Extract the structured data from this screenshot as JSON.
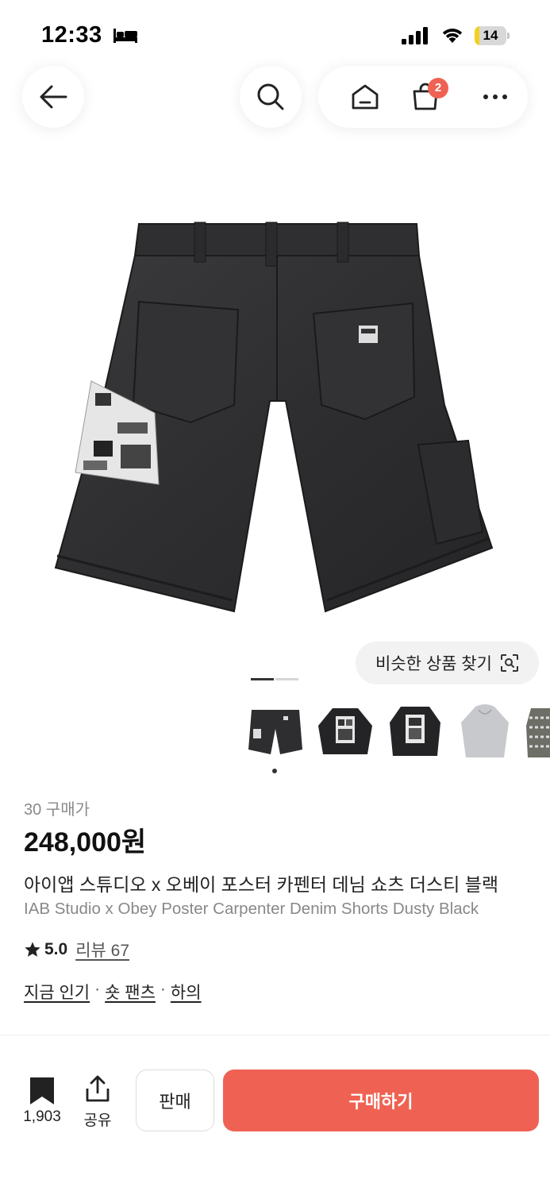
{
  "status_bar": {
    "time": "12:33",
    "battery_level": "14",
    "battery_fraction": 0.14
  },
  "nav": {
    "cart_count": "2"
  },
  "similar_search": {
    "label": "비슷한 상품 찾기"
  },
  "gallery": {
    "active_index": 0,
    "total_pages": 2
  },
  "product": {
    "buyer_count": "30 구매가",
    "price": "248,000원",
    "title_ko": "아이앱 스튜디오 x 오베이 포스터 카펜터 데님 쇼츠 더스티 블랙",
    "title_en": "IAB Studio x Obey Poster Carpenter Denim Shorts Dusty Black",
    "rating": "5.0",
    "reviews": "리뷰 67",
    "categories": [
      "지금 인기",
      "숏 팬츠",
      "하의"
    ]
  },
  "bottom_bar": {
    "save_count": "1,903",
    "share_label": "공유",
    "sell_label": "판매",
    "buy_label": "구매하기"
  },
  "colors": {
    "accent": "#ef6253",
    "battery": "#f2d024"
  }
}
